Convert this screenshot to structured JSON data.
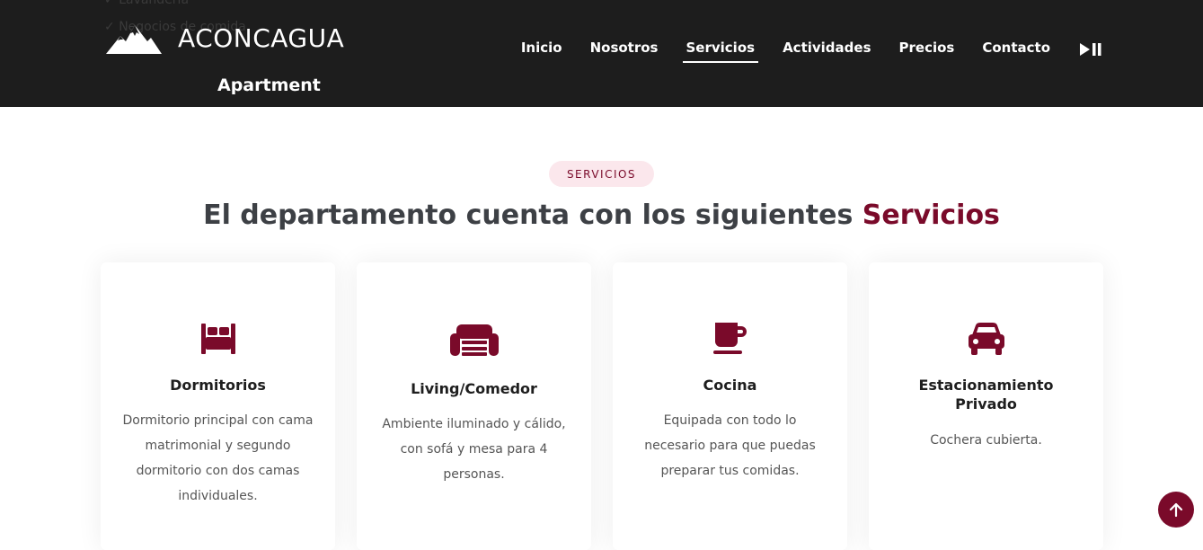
{
  "header": {
    "ghost_items": [
      "Lavandería",
      "Negocios de comida"
    ],
    "logo_title": "ACONCAGUA",
    "logo_subtitle": "Apartment",
    "nav": [
      {
        "label": "Inicio",
        "active": false
      },
      {
        "label": "Nosotros",
        "active": false
      },
      {
        "label": "Servicios",
        "active": true
      },
      {
        "label": "Actividades",
        "active": false
      },
      {
        "label": "Precios",
        "active": false
      },
      {
        "label": "Contacto",
        "active": false
      }
    ],
    "media_icon": "play-pause-icon"
  },
  "section": {
    "badge": "SERVICIOS",
    "heading_main": "El departamento cuenta con los siguientes ",
    "heading_accent": "Servicios"
  },
  "cards": [
    {
      "icon": "bed-icon",
      "title": "Dormitorios",
      "description": "Dormitorio principal con cama matrimonial y segundo dormitorio con dos camas individuales."
    },
    {
      "icon": "couch-icon",
      "title": "Living/Comedor",
      "description": "Ambiente iluminado y cálido, con sofá y mesa para 4 personas."
    },
    {
      "icon": "mug-icon",
      "title": "Cocina",
      "description": "Equipada con todo lo necesario para que puedas preparar tus comidas."
    },
    {
      "icon": "car-icon",
      "title": "Estacionamiento Privado",
      "description": "Cochera cubierta."
    }
  ],
  "scroll_top_icon": "arrow-up-icon",
  "colors": {
    "header_bg": "#1d1d1d",
    "accent": "#7a0a2a",
    "badge_bg": "#fbe7ec",
    "heading": "#3d4045"
  }
}
